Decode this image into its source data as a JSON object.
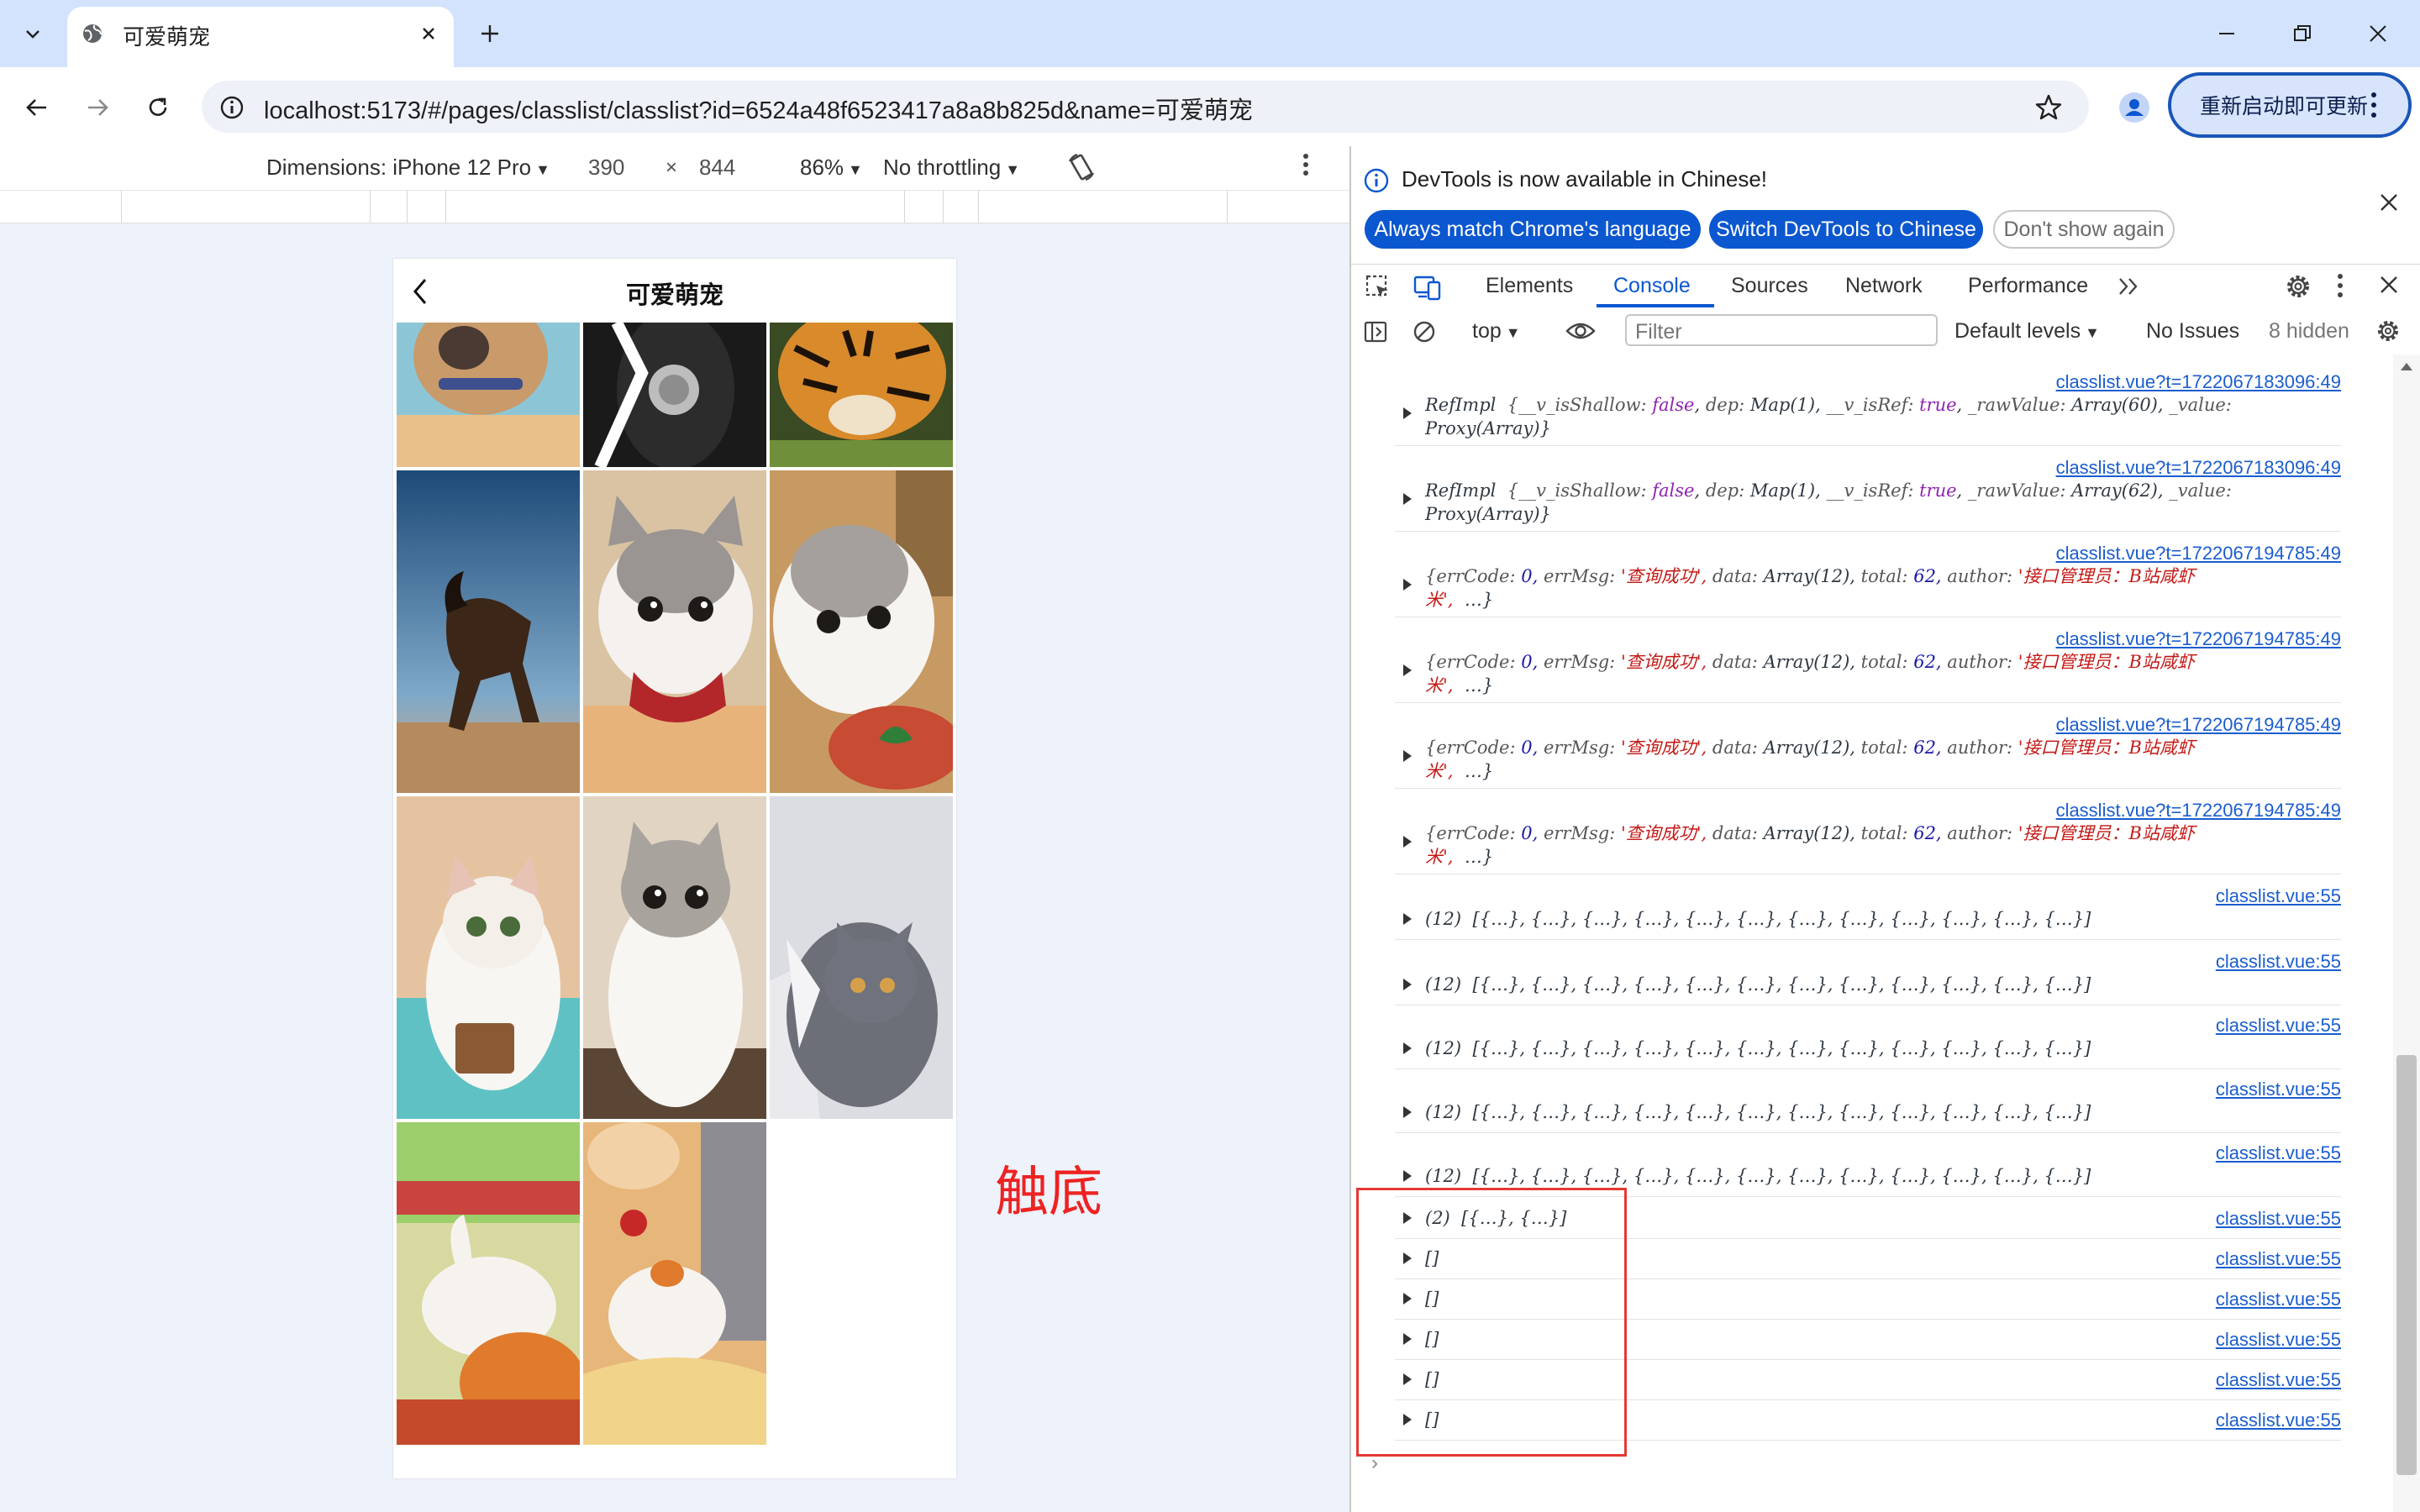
{
  "browser": {
    "tab_title": "可爱萌宠",
    "url": "localhost:5173/#/pages/classlist/classlist?id=6524a48f6523417a8a8b825d&name=可爱萌宠",
    "update_button_label": "重新启动即可更新"
  },
  "device_toolbar": {
    "dimensions_label": "Dimensions: iPhone 12 Pro",
    "width": "390",
    "x_sep": "×",
    "height": "844",
    "zoom": "86%",
    "throttling": "No throttling"
  },
  "phone": {
    "title": "可爱萌宠"
  },
  "annotation": {
    "label": "触底"
  },
  "devtools": {
    "info_text": "DevTools is now available in Chinese!",
    "btn_match": "Always match Chrome's language",
    "btn_switch": "Switch DevTools to Chinese",
    "btn_dont_show": "Don't show again",
    "tabs": [
      "Elements",
      "Console",
      "Sources",
      "Network",
      "Performance"
    ],
    "context": "top",
    "filter_placeholder": "Filter",
    "levels": "Default levels",
    "issues": "No Issues",
    "hidden": "8 hidden"
  },
  "console": {
    "logs": [
      {
        "src": "classlist.vue?t=1722067183096:49"
      },
      {
        "src": "classlist.vue?t=1722067183096:49"
      },
      {
        "src": "classlist.vue?t=1722067194785:49"
      },
      {
        "src": "classlist.vue?t=1722067194785:49"
      },
      {
        "src": "classlist.vue?t=1722067194785:49"
      },
      {
        "src": "classlist.vue?t=1722067194785:49"
      },
      {
        "src": "classlist.vue:55",
        "text": "(12)  [{…}, {…}, {…}, {…}, {…}, {…}, {…}, {…}, {…}, {…}, {…}, {…}]"
      },
      {
        "src": "classlist.vue:55",
        "text": "(12)  [{…}, {…}, {…}, {…}, {…}, {…}, {…}, {…}, {…}, {…}, {…}, {…}]"
      },
      {
        "src": "classlist.vue:55",
        "text": "(12)  [{…}, {…}, {…}, {…}, {…}, {…}, {…}, {…}, {…}, {…}, {…}, {…}]"
      },
      {
        "src": "classlist.vue:55",
        "text": "(12)  [{…}, {…}, {…}, {…}, {…}, {…}, {…}, {…}, {…}, {…}, {…}, {…}]"
      },
      {
        "src": "classlist.vue:55",
        "text": "(12)  [{…}, {…}, {…}, {…}, {…}, {…}, {…}, {…}, {…}, {…}, {…}, {…}]"
      },
      {
        "src": "classlist.vue:55",
        "text": "(2)  [{…}, {…}]"
      },
      {
        "src": "classlist.vue:55",
        "text": "[]"
      },
      {
        "src": "classlist.vue:55",
        "text": "[]"
      },
      {
        "src": "classlist.vue:55",
        "text": "[]"
      },
      {
        "src": "classlist.vue:55",
        "text": "[]"
      },
      {
        "src": "classlist.vue:55",
        "text": "[]"
      }
    ],
    "refimpl": {
      "name": "RefImpl",
      "k_shallow": "__v_isShallow:",
      "v_false": "false",
      "k_dep": "dep:",
      "v_dep": "Map(1),",
      "k_isref": "__v_isRef:",
      "v_true": "true",
      "k_raw": "_rawValue:",
      "v_raw_60": "Array(60),",
      "v_raw_62": "Array(62),",
      "k_value": "_value:",
      "v_proxy": "Proxy(Array)}"
    },
    "resp": {
      "k_code": "{errCode:",
      "v_code": "0,",
      "k_msg": "errMsg:",
      "v_msg": "'查询成功',",
      "k_data": "data:",
      "v_data": "Array(12),",
      "k_total": "total:",
      "v_total": "62,",
      "k_author": "author:",
      "v_author_a": "'接口管理员：B站咸虾",
      "v_author_b": "米',",
      "ellipsis": "…}"
    }
  },
  "colors": {
    "accent": "#0b57d0",
    "tabstrip": "#d3e3fd",
    "annotation": "#ee2222",
    "highlight_box": "#e53935"
  }
}
